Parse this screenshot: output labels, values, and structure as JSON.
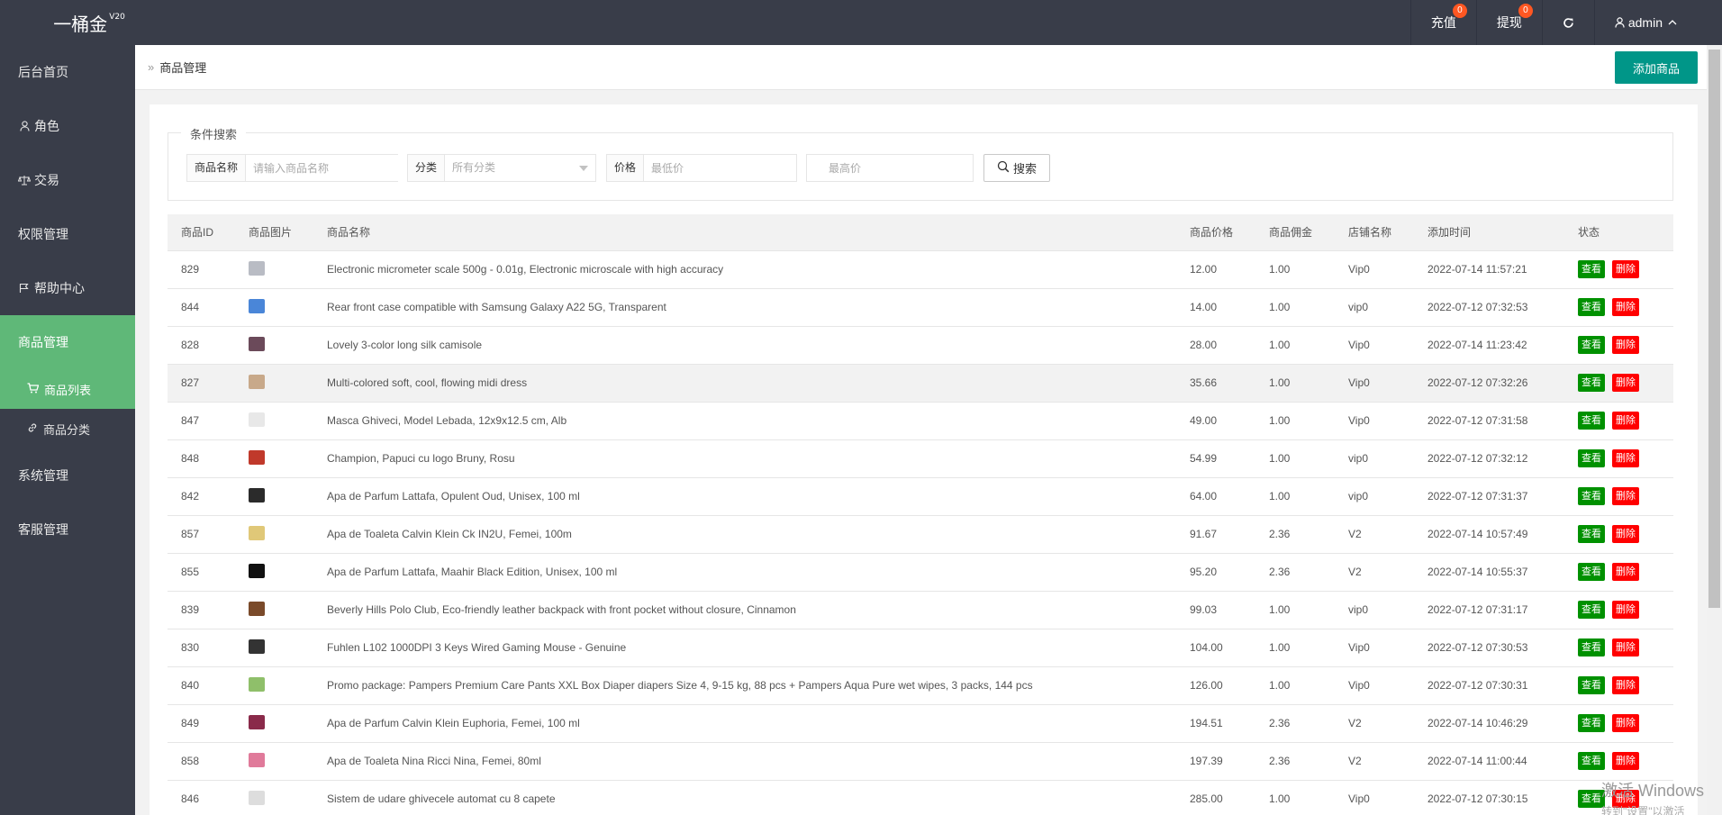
{
  "app": {
    "logo": "一桶金",
    "version": "V20"
  },
  "topbar": {
    "recharge_label": "充值",
    "recharge_badge": "0",
    "withdraw_label": "提现",
    "withdraw_badge": "0",
    "refresh_icon": "refresh-icon",
    "user_label": "admin"
  },
  "sidebar": {
    "items": [
      {
        "label": "后台首页",
        "icon": ""
      },
      {
        "label": "角色",
        "icon": "user-icon"
      },
      {
        "label": "交易",
        "icon": "scale-icon"
      },
      {
        "label": "权限管理",
        "icon": ""
      },
      {
        "label": "帮助中心",
        "icon": "flag-icon"
      },
      {
        "label": "商品管理",
        "icon": ""
      },
      {
        "label": "系统管理",
        "icon": ""
      },
      {
        "label": "客服管理",
        "icon": ""
      }
    ],
    "sub_items": [
      {
        "label": "商品列表",
        "icon": "cart-icon"
      },
      {
        "label": "商品分类",
        "icon": "link-icon"
      }
    ],
    "active_color": "#5fb878"
  },
  "header": {
    "breadcrumb": "商品管理",
    "add_button": "添加商品"
  },
  "search": {
    "legend": "条件搜索",
    "name_label": "商品名称",
    "name_placeholder": "请输入商品名称",
    "category_label": "分类",
    "category_value": "所有分类",
    "price_label": "价格",
    "min_placeholder": "最低价",
    "max_placeholder": "最高价",
    "button": "搜索"
  },
  "table": {
    "columns": [
      "商品ID",
      "商品图片",
      "商品名称",
      "商品价格",
      "商品佣金",
      "店铺名称",
      "添加时间",
      "状态"
    ],
    "view_label": "查看",
    "delete_label": "删除",
    "rows": [
      {
        "id": "829",
        "name": "Electronic micrometer scale 500g - 0.01g, Electronic microscale with high accuracy",
        "price": "12.00",
        "commission": "1.00",
        "shop": "Vip0",
        "time": "2022-07-14 11:57:21",
        "thumb": "#b9bcc4"
      },
      {
        "id": "844",
        "name": "Rear front case compatible with Samsung Galaxy A22 5G, Transparent",
        "price": "14.00",
        "commission": "1.00",
        "shop": "vip0",
        "time": "2022-07-12 07:32:53",
        "thumb": "#4a86d8"
      },
      {
        "id": "828",
        "name": "Lovely 3-color long silk camisole",
        "price": "28.00",
        "commission": "1.00",
        "shop": "Vip0",
        "time": "2022-07-14 11:23:42",
        "thumb": "#6b4a5a"
      },
      {
        "id": "827",
        "name": "Multi-colored soft, cool, flowing midi dress",
        "price": "35.66",
        "commission": "1.00",
        "shop": "Vip0",
        "time": "2022-07-12 07:32:26",
        "thumb": "#c8a98a"
      },
      {
        "id": "847",
        "name": "Masca Ghiveci, Model Lebada, 12x9x12.5 cm, Alb",
        "price": "49.00",
        "commission": "1.00",
        "shop": "Vip0",
        "time": "2022-07-12 07:31:58",
        "thumb": "#e8e8e8"
      },
      {
        "id": "848",
        "name": "Champion, Papuci cu logo Bruny, Rosu",
        "price": "54.99",
        "commission": "1.00",
        "shop": "vip0",
        "time": "2022-07-12 07:32:12",
        "thumb": "#c0392b"
      },
      {
        "id": "842",
        "name": "Apa de Parfum Lattafa, Opulent Oud, Unisex, 100 ml",
        "price": "64.00",
        "commission": "1.00",
        "shop": "vip0",
        "time": "2022-07-12 07:31:37",
        "thumb": "#2b2b2b"
      },
      {
        "id": "857",
        "name": "Apa de Toaleta Calvin Klein Ck IN2U, Femei, 100m",
        "price": "91.67",
        "commission": "2.36",
        "shop": "V2",
        "time": "2022-07-14 10:57:49",
        "thumb": "#e0c878"
      },
      {
        "id": "855",
        "name": "Apa de Parfum Lattafa, Maahir Black Edition, Unisex, 100 ml",
        "price": "95.20",
        "commission": "2.36",
        "shop": "V2",
        "time": "2022-07-14 10:55:37",
        "thumb": "#111111"
      },
      {
        "id": "839",
        "name": "Beverly Hills Polo Club, Eco-friendly leather backpack with front pocket without closure, Cinnamon",
        "price": "99.03",
        "commission": "1.00",
        "shop": "vip0",
        "time": "2022-07-12 07:31:17",
        "thumb": "#7a4a2a"
      },
      {
        "id": "830",
        "name": "Fuhlen L102 1000DPI 3 Keys Wired Gaming Mouse - Genuine",
        "price": "104.00",
        "commission": "1.00",
        "shop": "Vip0",
        "time": "2022-07-12 07:30:53",
        "thumb": "#333333"
      },
      {
        "id": "840",
        "name": "Promo package: Pampers Premium Care Pants XXL Box Diaper diapers Size 4, 9-15 kg, 88 pcs + Pampers Aqua Pure wet wipes, 3 packs, 144 pcs",
        "price": "126.00",
        "commission": "1.00",
        "shop": "Vip0",
        "time": "2022-07-12 07:30:31",
        "thumb": "#8fbf6a"
      },
      {
        "id": "849",
        "name": "Apa de Parfum Calvin Klein Euphoria, Femei, 100 ml",
        "price": "194.51",
        "commission": "2.36",
        "shop": "V2",
        "time": "2022-07-14 10:46:29",
        "thumb": "#8a2a4a"
      },
      {
        "id": "858",
        "name": "Apa de Toaleta Nina Ricci Nina, Femei, 80ml",
        "price": "197.39",
        "commission": "2.36",
        "shop": "V2",
        "time": "2022-07-14 11:00:44",
        "thumb": "#e07a9a"
      },
      {
        "id": "846",
        "name": "Sistem de udare ghivecele automat cu 8 capete",
        "price": "285.00",
        "commission": "1.00",
        "shop": "Vip0",
        "time": "2022-07-12 07:30:15",
        "thumb": "#dddddd"
      }
    ]
  },
  "overlay": {
    "windows_title": "激活 Windows",
    "windows_sub": "转到\"设置\"以激活 Windows。"
  }
}
